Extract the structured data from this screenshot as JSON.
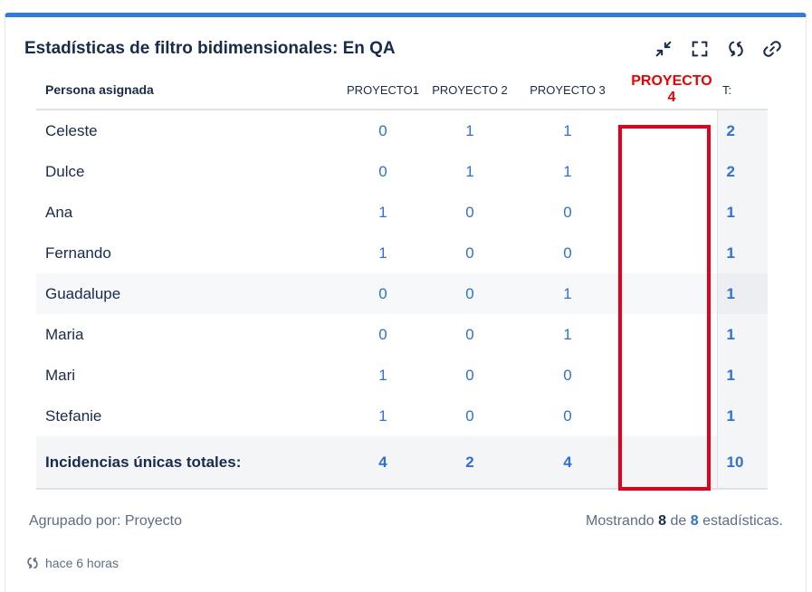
{
  "gadget": {
    "title": "Estadísticas de filtro bidimensionales: En QA",
    "accent_color": "#2f7be5",
    "actions": [
      {
        "name": "minimize-icon"
      },
      {
        "name": "fullscreen-icon"
      },
      {
        "name": "refresh-icon"
      },
      {
        "name": "link-icon"
      }
    ]
  },
  "table": {
    "headers": {
      "person": "Persona asignada",
      "p1": "PROYECTO1",
      "p2": "PROYECTO 2",
      "p3": "PROYECTO 3",
      "p4": "PROYECTO 4",
      "total": "T:"
    },
    "rows": [
      {
        "name": "Celeste",
        "p1": "0",
        "p2": "1",
        "p3": "1",
        "p4": "",
        "total": "2"
      },
      {
        "name": "Dulce",
        "p1": "0",
        "p2": "1",
        "p3": "1",
        "p4": "",
        "total": "2"
      },
      {
        "name": "Ana",
        "p1": "1",
        "p2": "0",
        "p3": "0",
        "p4": "",
        "total": "1"
      },
      {
        "name": "Fernando",
        "p1": "1",
        "p2": "0",
        "p3": "0",
        "p4": "",
        "total": "1"
      },
      {
        "name": "Guadalupe",
        "p1": "0",
        "p2": "0",
        "p3": "1",
        "p4": "",
        "total": "1"
      },
      {
        "name": "Maria",
        "p1": "0",
        "p2": "0",
        "p3": "1",
        "p4": "",
        "total": "1"
      },
      {
        "name": "Mari",
        "p1": "1",
        "p2": "0",
        "p3": "0",
        "p4": "",
        "total": "1"
      },
      {
        "name": "Stefanie",
        "p1": "1",
        "p2": "0",
        "p3": "0",
        "p4": "",
        "total": "1"
      }
    ],
    "summary": {
      "label": "Incidencias únicas totales:",
      "p1": "4",
      "p2": "2",
      "p3": "4",
      "p4": "",
      "total": "10"
    },
    "highlight_color": "#e3001b"
  },
  "footer": {
    "grouped_by": "Agrupado por: Proyecto",
    "showing_prefix": "Mostrando",
    "shown": "8",
    "of": "de",
    "total": "8",
    "suffix": "estadísticas.",
    "refreshed": "hace 6 horas"
  }
}
